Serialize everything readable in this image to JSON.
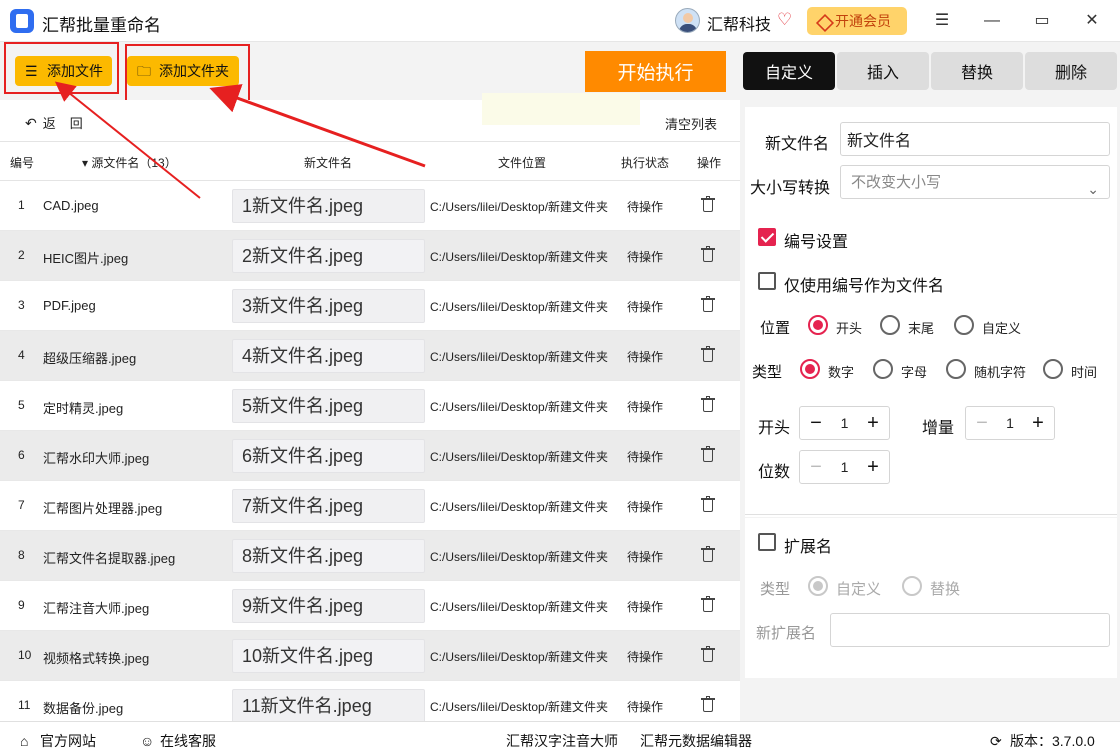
{
  "app": {
    "title": "汇帮批量重命名",
    "company": "汇帮科技",
    "vip_label": "开通会员",
    "window_controls": [
      "menu-icon",
      "minimize-icon",
      "maximize-icon",
      "close-icon"
    ]
  },
  "toolbar": {
    "add_file": "添加文件",
    "add_folder": "添加文件夹",
    "start": "开始执行",
    "back": "返",
    "back2": "回",
    "clear_list": "清空列表"
  },
  "tabs": [
    "自定义",
    "插入",
    "替换",
    "删除"
  ],
  "table": {
    "headers": {
      "num": "编号",
      "src": "▾ 源文件名（13）",
      "new": "新文件名",
      "path": "文件位置",
      "status": "执行状态",
      "op": "操作"
    },
    "rows": [
      {
        "num": "1",
        "src": "CAD.jpeg",
        "new": "1新文件名.jpeg",
        "path": "C:/Users/lilei/Desktop/新建文件夹",
        "status": "待操作"
      },
      {
        "num": "2",
        "src": "HEIC图片.jpeg",
        "new": "2新文件名.jpeg",
        "path": "C:/Users/lilei/Desktop/新建文件夹",
        "status": "待操作"
      },
      {
        "num": "3",
        "src": "PDF.jpeg",
        "new": "3新文件名.jpeg",
        "path": "C:/Users/lilei/Desktop/新建文件夹",
        "status": "待操作"
      },
      {
        "num": "4",
        "src": "超级压缩器.jpeg",
        "new": "4新文件名.jpeg",
        "path": "C:/Users/lilei/Desktop/新建文件夹",
        "status": "待操作"
      },
      {
        "num": "5",
        "src": "定时精灵.jpeg",
        "new": "5新文件名.jpeg",
        "path": "C:/Users/lilei/Desktop/新建文件夹",
        "status": "待操作"
      },
      {
        "num": "6",
        "src": "汇帮水印大师.jpeg",
        "new": "6新文件名.jpeg",
        "path": "C:/Users/lilei/Desktop/新建文件夹",
        "status": "待操作"
      },
      {
        "num": "7",
        "src": "汇帮图片处理器.jpeg",
        "new": "7新文件名.jpeg",
        "path": "C:/Users/lilei/Desktop/新建文件夹",
        "status": "待操作"
      },
      {
        "num": "8",
        "src": "汇帮文件名提取器.jpeg",
        "new": "8新文件名.jpeg",
        "path": "C:/Users/lilei/Desktop/新建文件夹",
        "status": "待操作"
      },
      {
        "num": "9",
        "src": "汇帮注音大师.jpeg",
        "new": "9新文件名.jpeg",
        "path": "C:/Users/lilei/Desktop/新建文件夹",
        "status": "待操作"
      },
      {
        "num": "10",
        "src": "视频格式转换.jpeg",
        "new": "10新文件名.jpeg",
        "path": "C:/Users/lilei/Desktop/新建文件夹",
        "status": "待操作"
      },
      {
        "num": "11",
        "src": "数据备份.jpeg",
        "new": "11新文件名.jpeg",
        "path": "C:/Users/lilei/Desktop/新建文件夹",
        "status": "待操作"
      }
    ]
  },
  "settings": {
    "new_name_label": "新文件名",
    "new_name_value": "新文件名",
    "case_label": "大小写转换",
    "case_value": "不改变大小写",
    "numbering_label": "编号设置",
    "numbering_checked": true,
    "only_number_label": "仅使用编号作为文件名",
    "position_label": "位置",
    "position_options": [
      "开头",
      "末尾",
      "自定义"
    ],
    "type_label": "类型",
    "type_options": [
      "数字",
      "字母",
      "随机字符",
      "时间"
    ],
    "start_label": "开头",
    "start_value": "1",
    "increment_label": "增量",
    "increment_value": "1",
    "digits_label": "位数",
    "digits_value": "1",
    "ext_label": "扩展名",
    "ext_type_label": "类型",
    "ext_type_options": [
      "自定义",
      "替换"
    ],
    "new_ext_label": "新扩展名",
    "new_ext_value": ""
  },
  "statusbar": {
    "website": "官方网站",
    "support": "在线客服",
    "app1": "汇帮汉字注音大师",
    "app2": "汇帮元数据编辑器",
    "version": "版本：3.7.0.0"
  },
  "colors": {
    "accent": "#e5234f",
    "add_button": "#fcb900",
    "start_button": "#ff8a00",
    "annotation_red": "#e62020"
  }
}
